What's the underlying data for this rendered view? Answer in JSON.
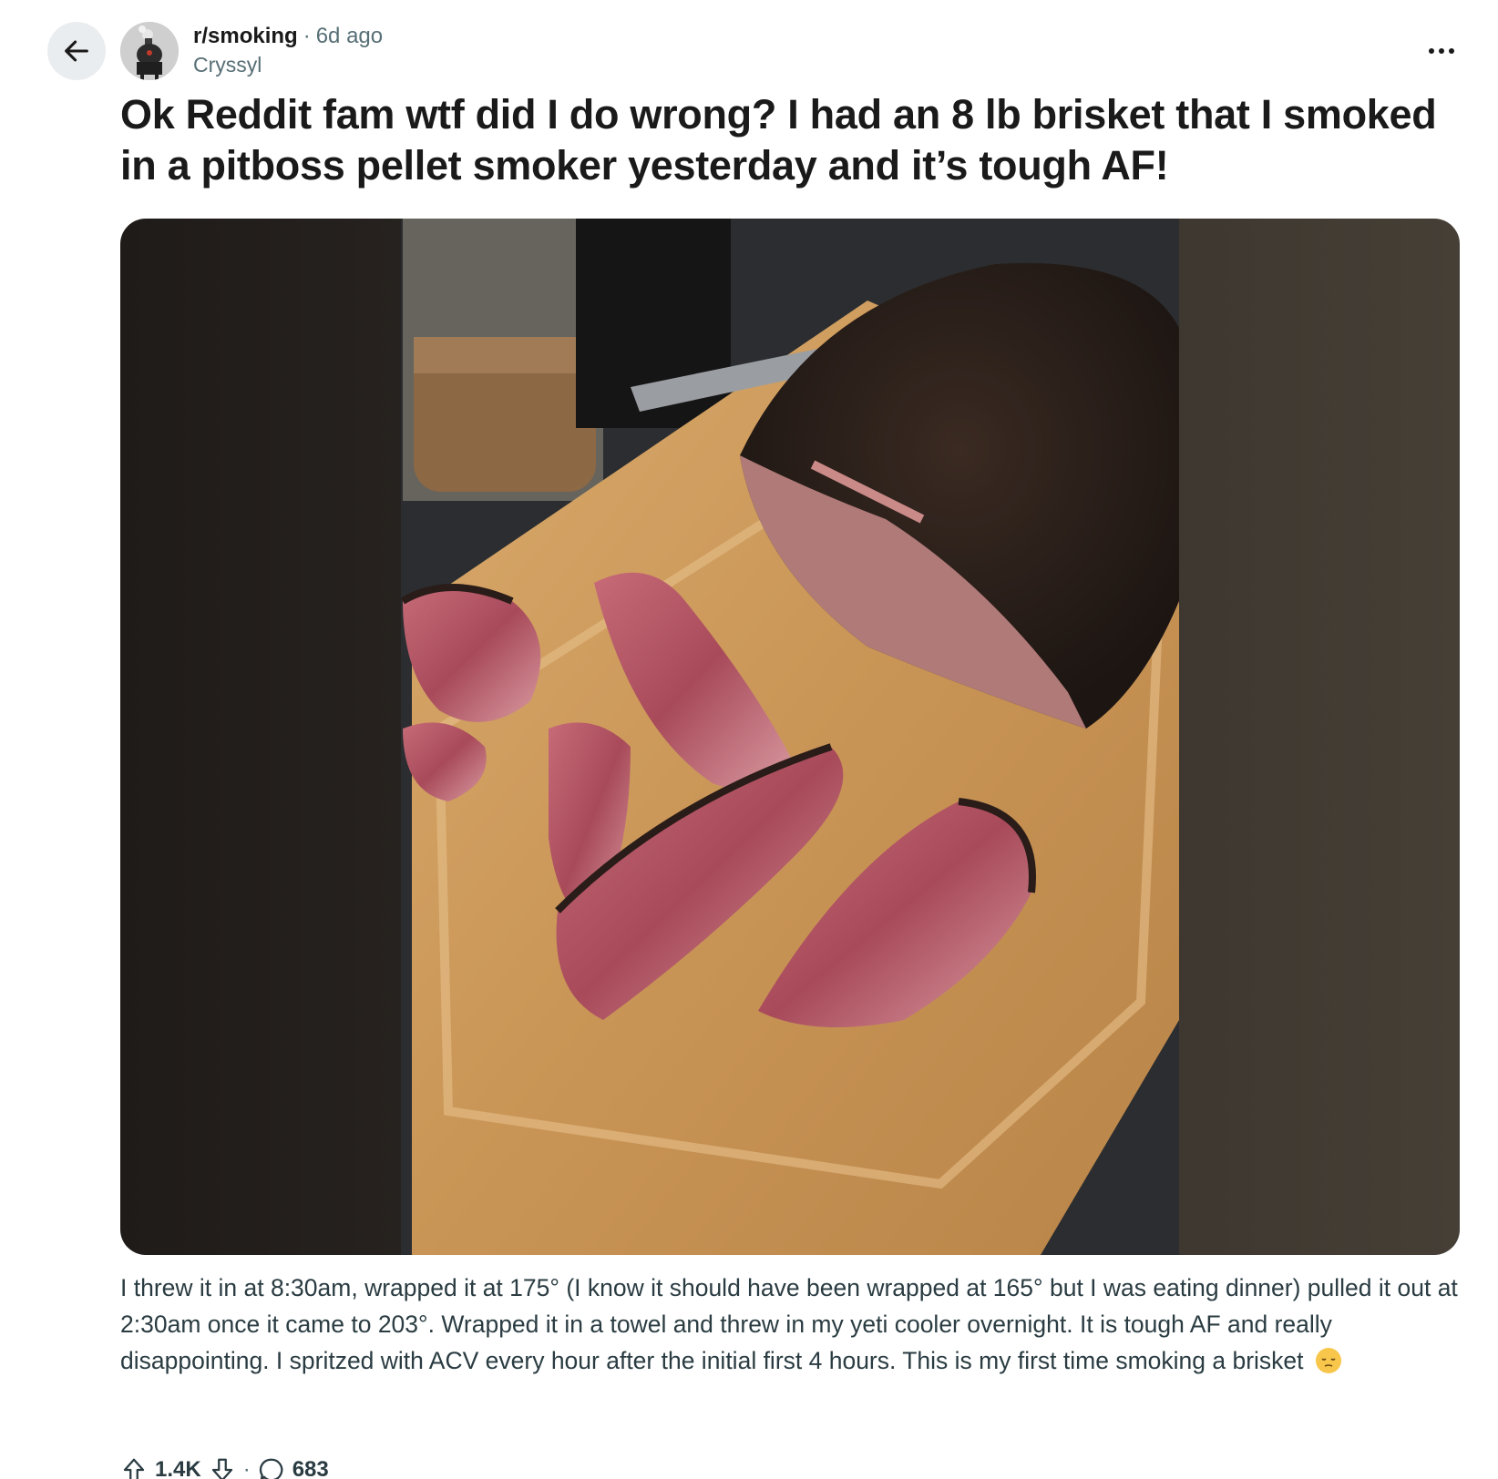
{
  "post": {
    "subreddit": "r/smoking",
    "separator": "·",
    "age": "6d ago",
    "author": "Cryssyl",
    "title": "Ok Reddit fam wtf did I do wrong? I had an 8 lb brisket that I smoked in a pitboss pellet smoker yesterday and it’s tough AF!",
    "body": "I threw it in at 8:30am, wrapped it at 175° (I know it should have been wrapped at 165° but I was eating dinner) pulled it out at 2:30am once it came to 203°. Wrapped it in a towel and threw in my yeti cooler overnight. It is tough AF and really disappointing. I spritzed with ACV every hour after the initial first 4 hours. This is my first time smoking a brisket",
    "emoji": "pensive-face"
  },
  "actions": {
    "upvotes": "1.4K",
    "separator": "·",
    "comments": "683"
  },
  "icons": {
    "back": "arrow-left-icon",
    "more": "more-horizontal-icon",
    "upvote": "upvote-arrow-icon",
    "downvote": "downvote-arrow-icon",
    "comment": "comment-bubble-icon"
  },
  "colors": {
    "meta_grey": "#576f76",
    "body_text": "#2a3c42",
    "button_bg": "#eaedef"
  }
}
